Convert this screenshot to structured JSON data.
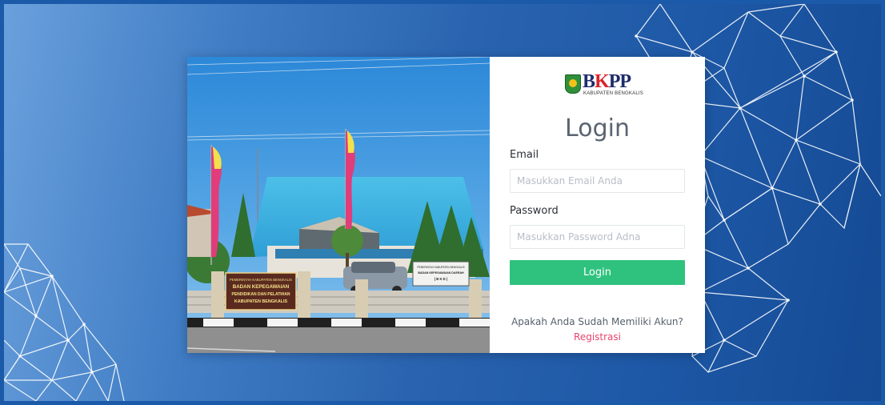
{
  "logo": {
    "name": "BKPP",
    "sub": "KABUPATEN BENGKALIS"
  },
  "login": {
    "title": "Login",
    "email_label": "Email",
    "email_placeholder": "Masukkan Email Anda",
    "password_label": "Password",
    "password_placeholder": "Masukkan Password Adna",
    "submit_label": "Login"
  },
  "register": {
    "question": "Apakah Anda Sudah Memiliki Akun?",
    "link_label": "Registrasi"
  },
  "photo": {
    "sign_left": [
      "PEMERINTAH KABUPATEN BENGKALIS",
      "BADAN KEPEGAWAIAN",
      "PENDIDIKAN DAN PELATIHAN",
      "KABUPATEN BENGKALIS"
    ],
    "sign_right": [
      "PEMERINTAH KABUPATEN BENGKALIS",
      "BADAN KEPEGAWAIAN DAERAH",
      "( B K D )"
    ]
  },
  "colors": {
    "accent": "#2ec27e",
    "link": "#e9436b",
    "background": "#2a64b0"
  }
}
